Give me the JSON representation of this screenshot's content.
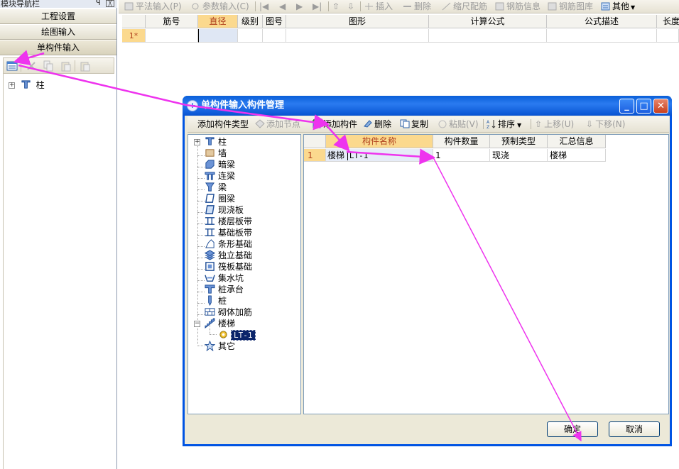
{
  "nav": {
    "title": "模块导航栏",
    "pin_glyph": "ꟼ",
    "close_glyph": "╳",
    "buttons": [
      "工程设置",
      "绘图输入",
      "单构件输入"
    ],
    "tree_root": "柱"
  },
  "toolbar": {
    "pingfa": "平法输入(P)",
    "canshu": "参数输入(C)",
    "charu": "插入",
    "shanchu": "删除",
    "suochi": "缩尺配筋",
    "gangjin_info": "钢筋信息",
    "gangjin_tuku": "钢筋图库",
    "qita": "其他"
  },
  "grid": {
    "headers": [
      "筋号",
      "直径(mm)",
      "级别",
      "图号",
      "图形",
      "计算公式",
      "公式描述",
      "长度"
    ],
    "row_label": "1*"
  },
  "dialog": {
    "title": "单构件输入构件管理",
    "window_buttons": {
      "minimize": "_",
      "maximize": "□",
      "close": "✕"
    },
    "toolbar": {
      "add_type": "添加构件类型",
      "add_node": "添加节点",
      "add_component": "添加构件",
      "delete": "删除",
      "copy": "复制",
      "paste": "粘贴(V)",
      "sort": "排序",
      "move_up": "上移(U)",
      "move_down": "下移(N)"
    },
    "tree": [
      "柱",
      "墙",
      "暗梁",
      "连梁",
      "梁",
      "圈梁",
      "现浇板",
      "楼层板带",
      "基础板带",
      "条形基础",
      "独立基础",
      "筏板基础",
      "集水坑",
      "桩承台",
      "桩",
      "砌体加筋",
      "楼梯",
      "LT-1",
      "其它"
    ],
    "table": {
      "headers": [
        "构件名称",
        "构件数量",
        "预制类型",
        "汇总信息"
      ],
      "rows": [
        {
          "no": "1",
          "name_prefix": "楼梯",
          "name": "LT-1",
          "count": "1",
          "type": "现浇",
          "summary": "楼梯"
        }
      ]
    },
    "ok_label": "确定",
    "cancel_label": "取消"
  },
  "colors": {
    "arrow": "#ee33ee",
    "title_bar": "#0a5fd8",
    "header_highlight": "#fbd98e",
    "selection": "#0a246a"
  }
}
